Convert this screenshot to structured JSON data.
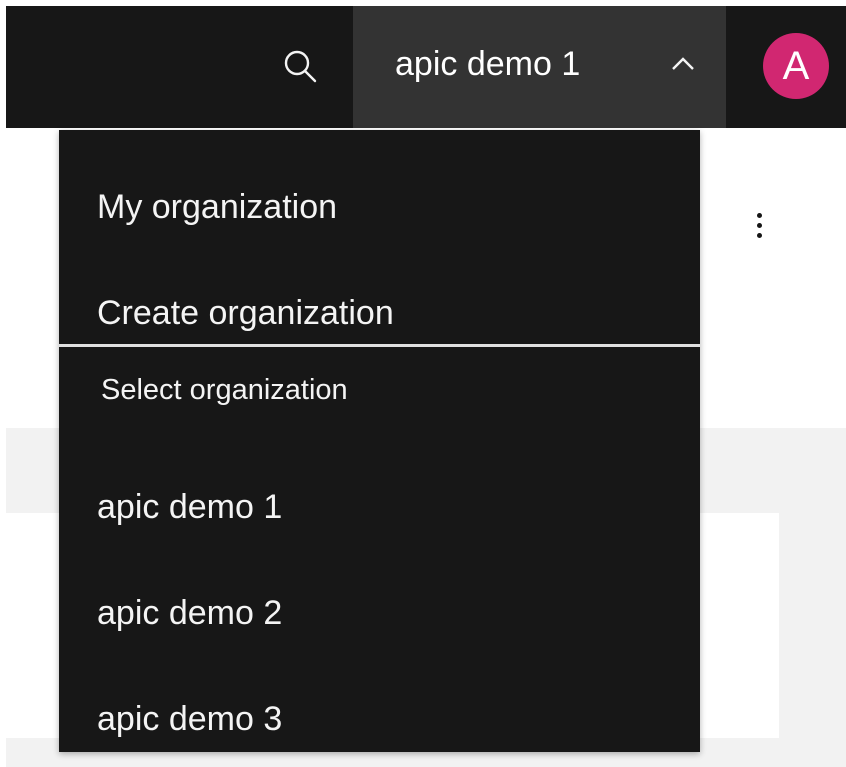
{
  "header": {
    "search_icon": "search-icon",
    "org_switcher": {
      "label": "apic demo 1",
      "icon": "chevron-up-icon"
    },
    "avatar": {
      "initial": "A",
      "color": "#d12771"
    }
  },
  "page": {
    "overflow_icon": "overflow-menu-vertical-icon"
  },
  "org_menu": {
    "items": [
      {
        "label": "My organization"
      },
      {
        "label": "Create organization"
      }
    ],
    "section_label": "Select organization",
    "organizations": [
      {
        "label": "apic demo 1"
      },
      {
        "label": "apic demo 2"
      },
      {
        "label": "apic demo 3"
      }
    ]
  },
  "colors": {
    "header_bg": "#171717",
    "switcher_bg": "#333333",
    "menu_bg": "#171717",
    "text": "#f4f4f4",
    "surface": "#f2f2f2"
  }
}
